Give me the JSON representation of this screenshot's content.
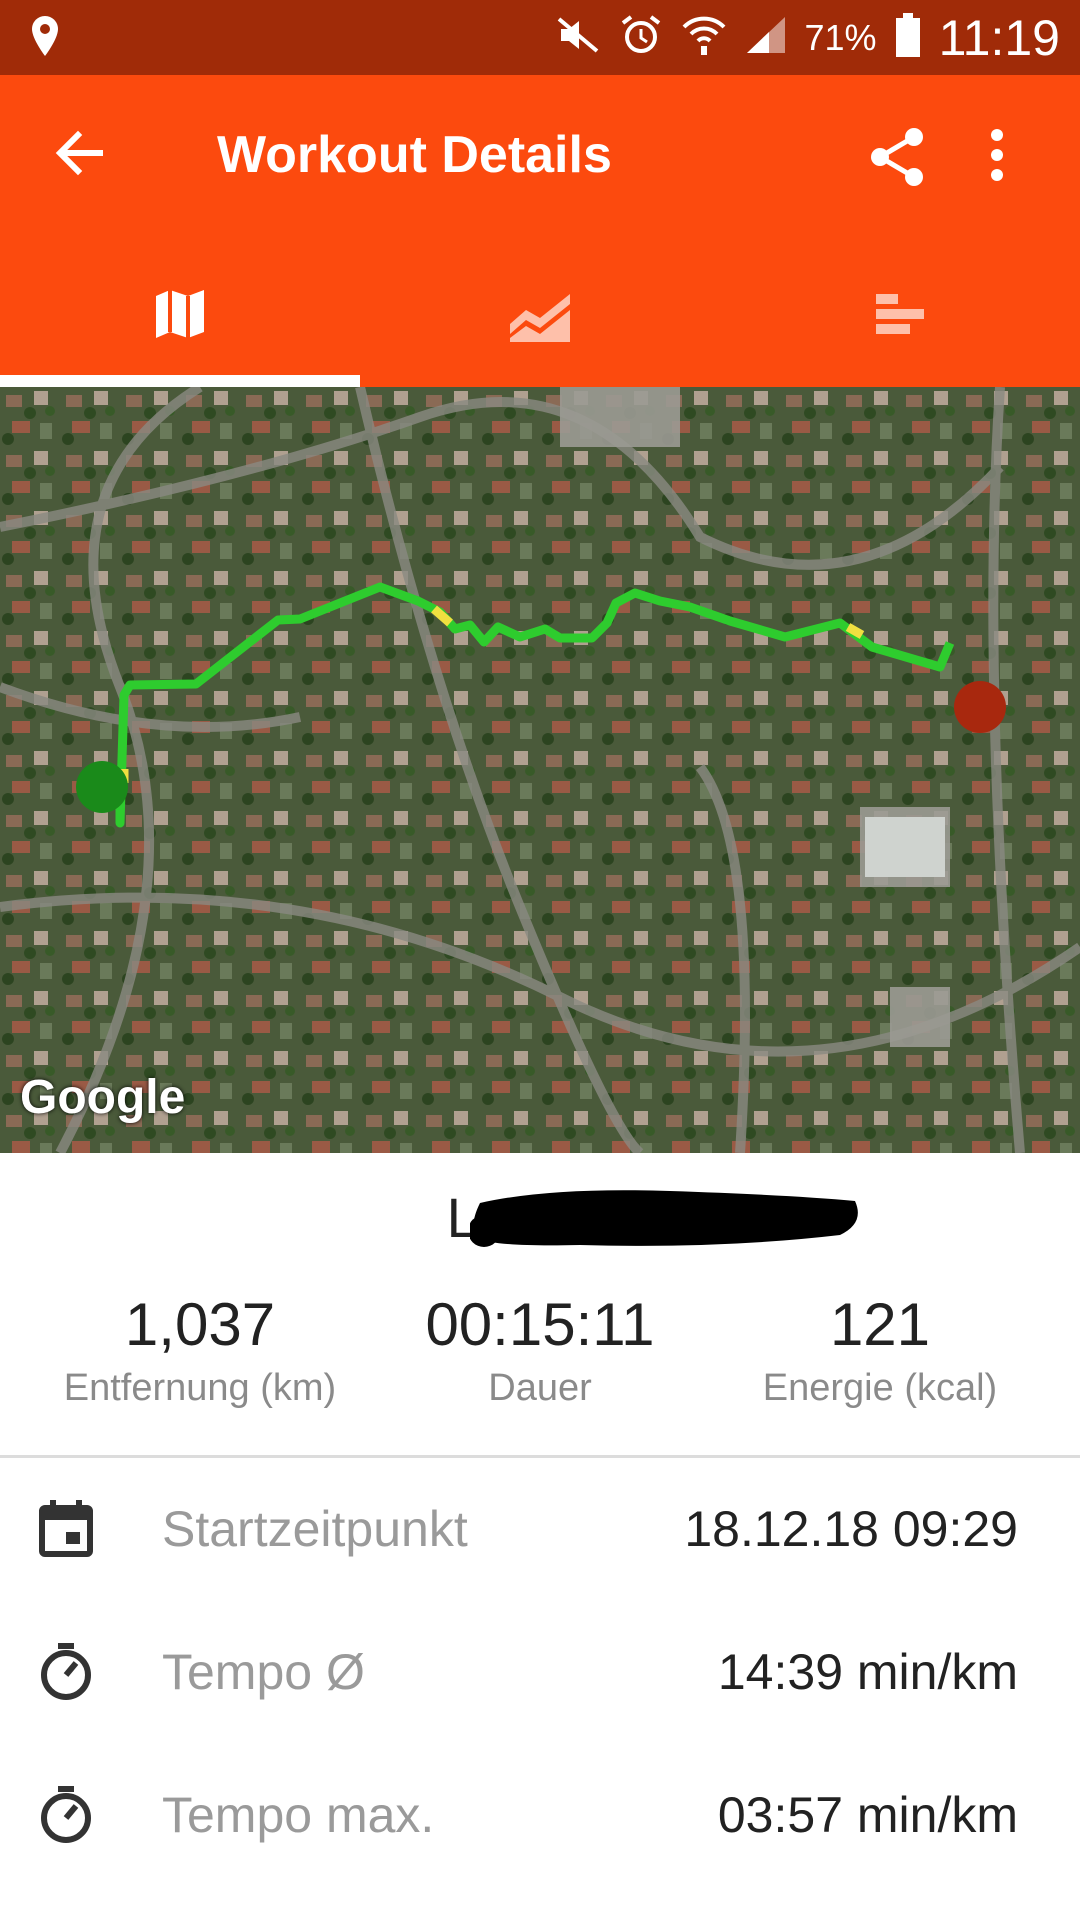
{
  "status_bar": {
    "battery_percent": "71%",
    "time": "11:19",
    "icons": [
      "location-icon",
      "mute-icon",
      "alarm-icon",
      "wifi-icon",
      "signal-icon",
      "battery-icon"
    ]
  },
  "app_bar": {
    "title": "Workout Details",
    "icons": [
      "back-arrow-icon",
      "share-icon",
      "more-vert-icon"
    ]
  },
  "tabs": [
    {
      "icon": "map-icon",
      "selected": true
    },
    {
      "icon": "chart-icon",
      "selected": false
    },
    {
      "icon": "bars-icon",
      "selected": false
    }
  ],
  "map": {
    "attribution": "Google",
    "route_color": "#2ecc2e",
    "start_marker_color": "#1a8a1a",
    "end_marker_color": "#a8280e"
  },
  "workout": {
    "name": "Laufen,"
  },
  "stats": [
    {
      "value": "1,037",
      "label": "Entfernung (km)"
    },
    {
      "value": "00:15:11",
      "label": "Dauer"
    },
    {
      "value": "121",
      "label": "Energie (kcal)"
    }
  ],
  "details": [
    {
      "icon": "calendar-icon",
      "label": "Startzeitpunkt",
      "value": "18.12.18 09:29"
    },
    {
      "icon": "stopwatch-icon",
      "label": "Tempo Ø",
      "value": "14:39 min/km"
    },
    {
      "icon": "stopwatch-icon",
      "label": "Tempo max.",
      "value": "03:57 min/km"
    }
  ],
  "colors": {
    "status_bar": "#a02b08",
    "app_bar": "#fc4a0e",
    "tab_indicator": "#ffffff"
  }
}
